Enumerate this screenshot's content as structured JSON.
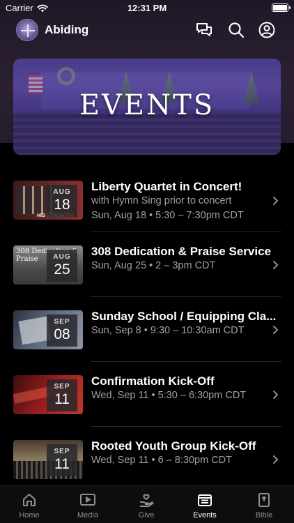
{
  "status_bar": {
    "carrier": "Carrier",
    "time": "12:31 PM"
  },
  "header": {
    "title": "Abiding",
    "icons": [
      "chat-bubbles-icon",
      "search-icon",
      "profile-icon"
    ]
  },
  "banner": {
    "title": "EVENTS"
  },
  "events": [
    {
      "title": "Liberty Quartet in Concert!",
      "subtitle": "with Hymn Sing prior to concert",
      "when": "Sun, Aug 18 • 5:30 – 7:30pm CDT",
      "month": "AUG",
      "day": "18",
      "thumb_caption": "HIS STRENGTH"
    },
    {
      "title": "308 Dedication & Praise Service",
      "when": "Sun, Aug 25 • 2 – 3pm CDT",
      "month": "AUG",
      "day": "25",
      "thumb_caption": "308 Dedication & Praise"
    },
    {
      "title": "Sunday School / Equipping Cla...",
      "when": "Sun, Sep 8 • 9:30 – 10:30am CDT",
      "month": "SEP",
      "day": "08"
    },
    {
      "title": "Confirmation Kick-Off",
      "when": "Wed, Sep 11 • 5:30 – 6:30pm CDT",
      "month": "SEP",
      "day": "11"
    },
    {
      "title": "Rooted Youth Group Kick-Off",
      "when": "Wed, Sep 11 • 6 – 8:30pm CDT",
      "month": "SEP",
      "day": "11"
    }
  ],
  "tabs": [
    {
      "label": "Home",
      "icon": "home-icon"
    },
    {
      "label": "Media",
      "icon": "play-icon"
    },
    {
      "label": "Give",
      "icon": "give-heart-hand-icon"
    },
    {
      "label": "Events",
      "icon": "events-icon",
      "active": true
    },
    {
      "label": "Bible",
      "icon": "bible-icon"
    }
  ],
  "colors": {
    "background": "#000000",
    "header_bg": "#2b2033",
    "secondary_text": "#a0a0a6",
    "tab_inactive": "#8e8e93"
  }
}
